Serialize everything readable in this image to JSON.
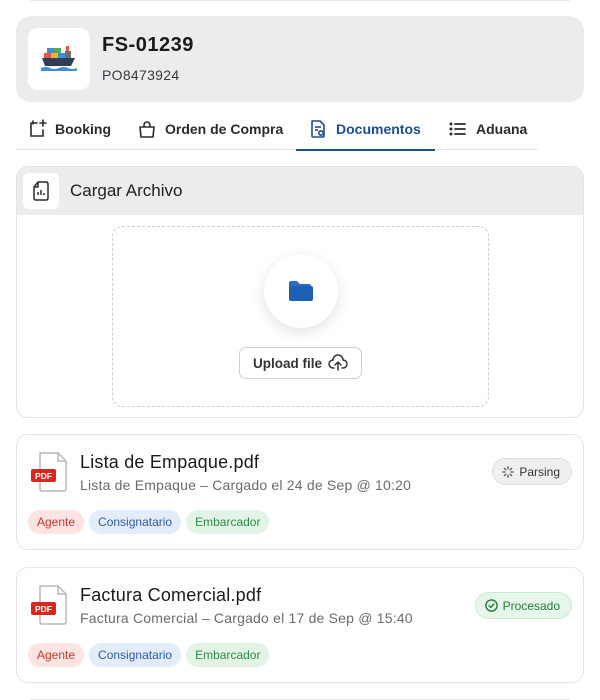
{
  "shipment": {
    "id": "FS-01239",
    "po": "PO8473924"
  },
  "tabs": [
    {
      "label": "Booking",
      "icon": "calendar-plus-icon"
    },
    {
      "label": "Orden de Compra",
      "icon": "shopping-bag-icon"
    },
    {
      "label": "Documentos",
      "icon": "document-icon",
      "active": true
    },
    {
      "label": "Aduana",
      "icon": "list-icon"
    }
  ],
  "upload": {
    "title": "Cargar Archivo",
    "button_label": "Upload file"
  },
  "documents": [
    {
      "name": "Lista de Empaque.pdf",
      "meta": "Lista de Empaque – Cargado el 24 de Sep @ 10:20",
      "status": "Parsing",
      "tags": [
        "Agente",
        "Consignatario",
        "Embarcador"
      ]
    },
    {
      "name": "Factura Comercial.pdf",
      "meta": "Factura Comercial – Cargado el 17 de Sep @ 15:40",
      "status": "Procesado",
      "tags": [
        "Agente",
        "Consignatario",
        "Embarcador"
      ]
    }
  ],
  "colors": {
    "accent": "#1c4f8f",
    "tag_agente": "#c0392b",
    "tag_consignatario": "#2c5da8",
    "tag_embarcador": "#2f8a47",
    "status_done": "#1f7a3a"
  }
}
